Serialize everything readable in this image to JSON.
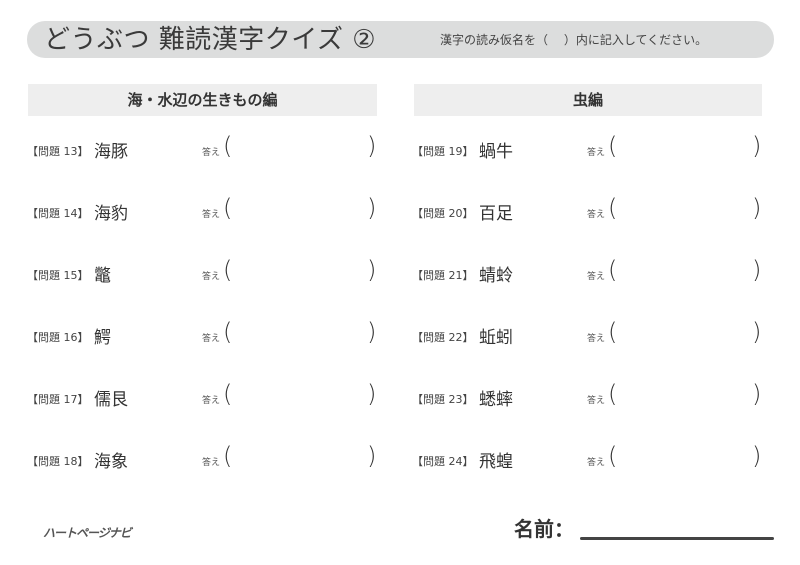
{
  "header": {
    "title": "どうぶつ 難読漢字クイズ ②",
    "instruction": "漢字の読み仮名を（　 ）内に記入してください。"
  },
  "sections": [
    {
      "title": "海・水辺の生きもの編",
      "questions": [
        {
          "number": "【問題 13】",
          "word": "海豚",
          "answer_label": "答え",
          "answer": ""
        },
        {
          "number": "【問題 14】",
          "word": "海豹",
          "answer_label": "答え",
          "answer": ""
        },
        {
          "number": "【問題 15】",
          "word": "鼈",
          "answer_label": "答え",
          "answer": ""
        },
        {
          "number": "【問題 16】",
          "word": "鰐",
          "answer_label": "答え",
          "answer": ""
        },
        {
          "number": "【問題 17】",
          "word": "儒艮",
          "answer_label": "答え",
          "answer": ""
        },
        {
          "number": "【問題 18】",
          "word": "海象",
          "answer_label": "答え",
          "answer": ""
        }
      ]
    },
    {
      "title": "虫編",
      "questions": [
        {
          "number": "【問題 19】",
          "word": "蝸牛",
          "answer_label": "答え",
          "answer": ""
        },
        {
          "number": "【問題 20】",
          "word": "百足",
          "answer_label": "答え",
          "answer": ""
        },
        {
          "number": "【問題 21】",
          "word": "蜻蛉",
          "answer_label": "答え",
          "answer": ""
        },
        {
          "number": "【問題 22】",
          "word": "蚯蚓",
          "answer_label": "答え",
          "answer": ""
        },
        {
          "number": "【問題 23】",
          "word": "蟋蟀",
          "answer_label": "答え",
          "answer": ""
        },
        {
          "number": "【問題 24】",
          "word": "飛蝗",
          "answer_label": "答え",
          "answer": ""
        }
      ]
    }
  ],
  "paren": {
    "open": "(",
    "close": ")"
  },
  "footer": {
    "logo": "ハートページナビ",
    "name_label": "名前："
  }
}
